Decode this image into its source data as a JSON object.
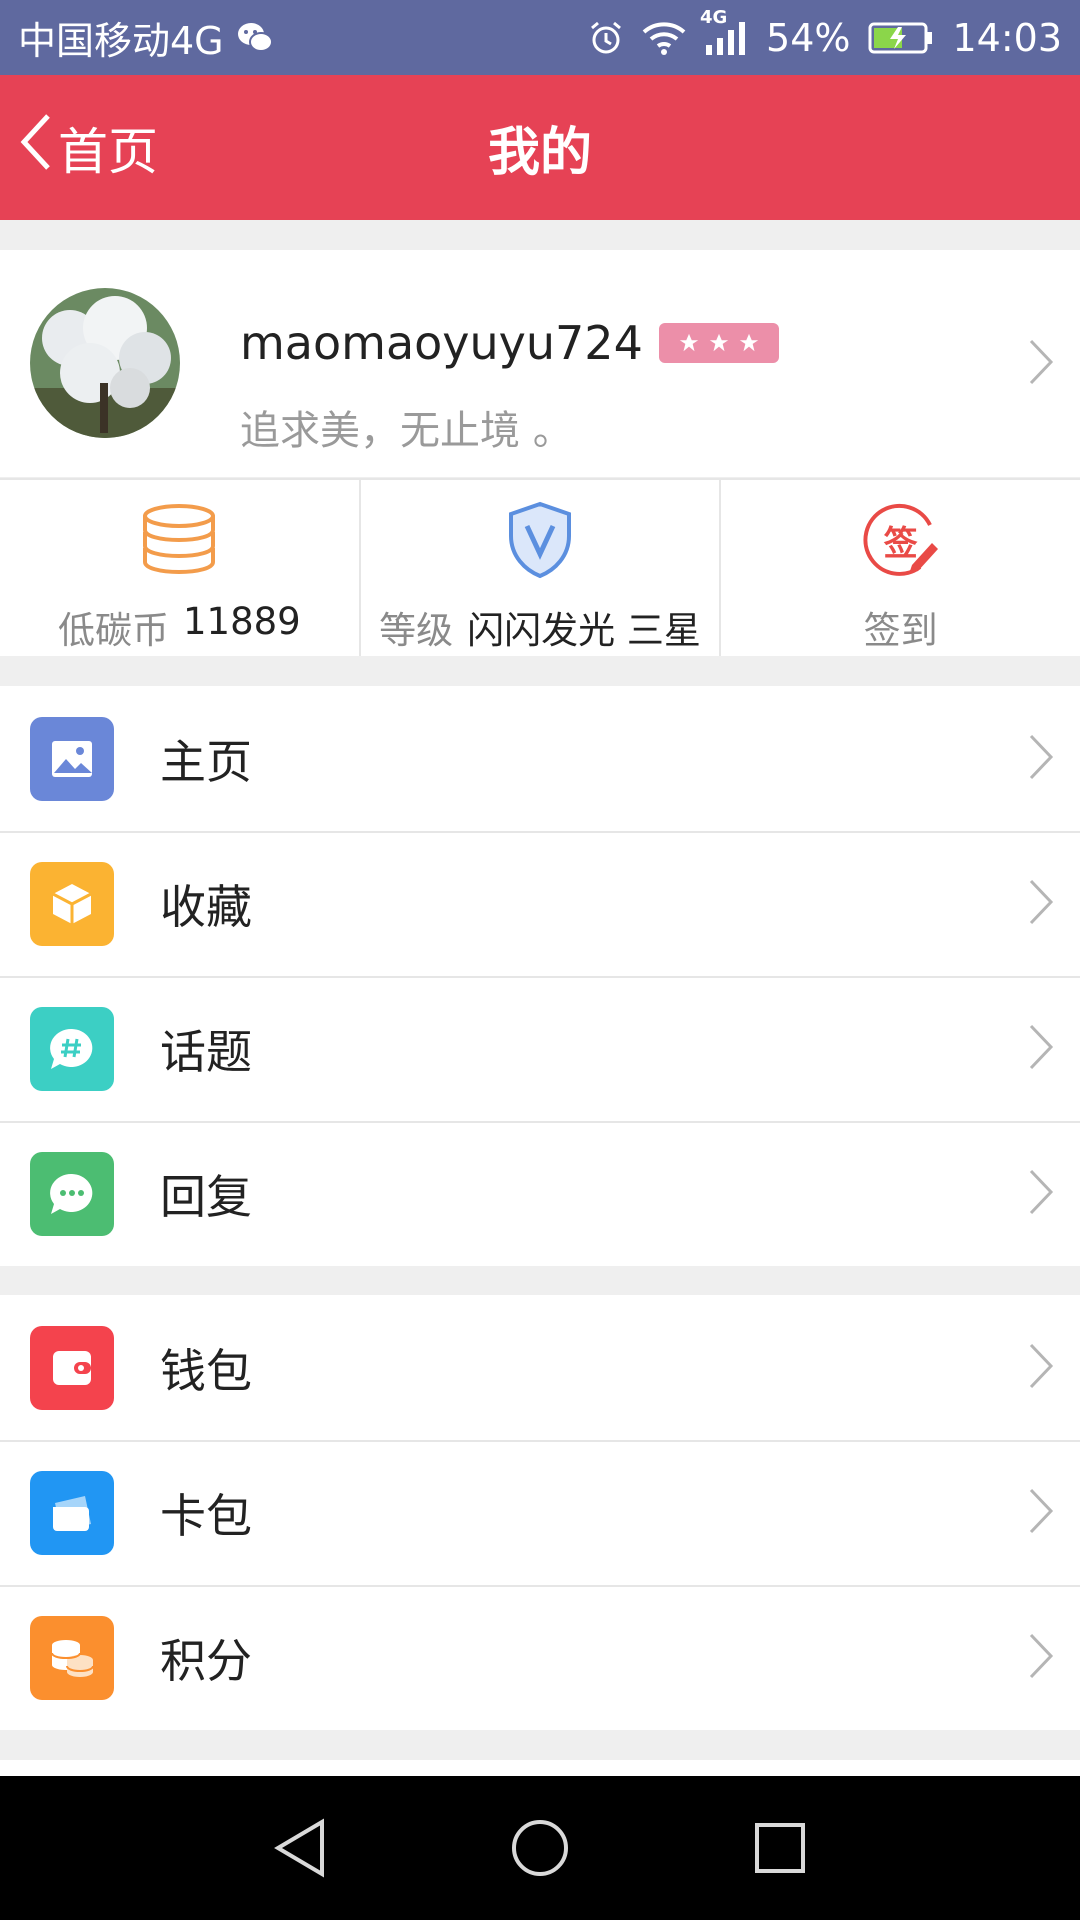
{
  "status_bar": {
    "carrier": "中国移动4G",
    "network": "4G",
    "battery": "54%",
    "time": "14:03"
  },
  "nav": {
    "back_label": "首页",
    "title": "我的"
  },
  "profile": {
    "username": "maomaoyuyu724",
    "stars": 3,
    "signature": "追求美，无止境 。"
  },
  "stats": {
    "coins_label": "低碳币",
    "coins_value": "11889",
    "level_label": "等级",
    "level_value": "闪闪发光 三星",
    "checkin_label": "签到",
    "checkin_icon_text": "签"
  },
  "menu_group_1": [
    {
      "label": "主页",
      "icon": "image-icon",
      "color": "#6a87d8"
    },
    {
      "label": "收藏",
      "icon": "box-icon",
      "color": "#fbb332"
    },
    {
      "label": "话题",
      "icon": "hashtag-bubble-icon",
      "color": "#3ccfc4"
    },
    {
      "label": "回复",
      "icon": "chat-bubble-icon",
      "color": "#4cbd72"
    }
  ],
  "menu_group_2": [
    {
      "label": "钱包",
      "icon": "wallet-icon",
      "color": "#f4434d"
    },
    {
      "label": "卡包",
      "icon": "card-icon",
      "color": "#2196f3"
    },
    {
      "label": "积分",
      "icon": "coins-stack-icon",
      "color": "#fb8f2e"
    }
  ],
  "colors": {
    "status_bar": "#5f699f",
    "nav_bar": "#e64255",
    "coin_icon": "#f39c4b",
    "level_icon": "#5b8fdf",
    "checkin_icon": "#e94a46"
  }
}
